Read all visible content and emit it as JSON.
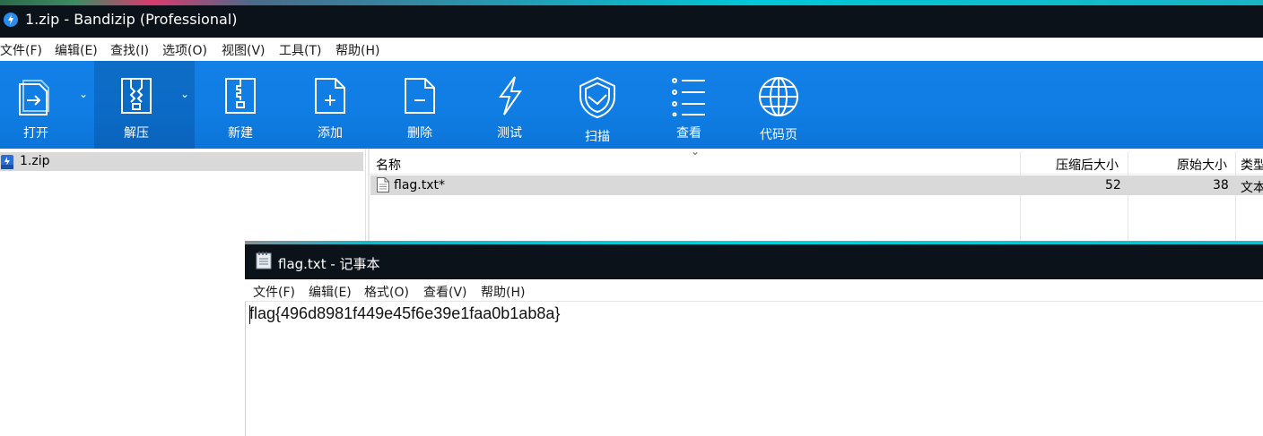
{
  "bandizip": {
    "title": "1.zip - Bandizip (Professional)",
    "menu": [
      "文件(F)",
      "编辑(E)",
      "查找(I)",
      "选项(O)",
      "视图(V)",
      "工具(T)",
      "帮助(H)"
    ],
    "toolbar": {
      "open": "打开",
      "extract": "解压",
      "new": "新建",
      "add": "添加",
      "delete": "删除",
      "test": "测试",
      "scan": "扫描",
      "view": "查看",
      "codepage": "代码页"
    },
    "tree": {
      "item": "1.zip"
    },
    "list": {
      "headers": {
        "name": "名称",
        "compressed": "压缩后大小",
        "original": "原始大小",
        "type": "类型"
      },
      "rows": [
        {
          "name": "flag.txt*",
          "compressed": "52",
          "original": "38",
          "type": "文本"
        }
      ]
    }
  },
  "notepad": {
    "title": "flag.txt - 记事本",
    "menu": [
      "文件(F)",
      "编辑(E)",
      "格式(O)",
      "查看(V)",
      "帮助(H)"
    ],
    "content": "flag{496d8981f449e45f6e39e1faa0b1ab8a}"
  },
  "colors": {
    "titlebar": "#0b1219",
    "toolbar": "#0f7de3",
    "selection": "#d9d9d9",
    "accent_strip": "#00c8d8"
  }
}
